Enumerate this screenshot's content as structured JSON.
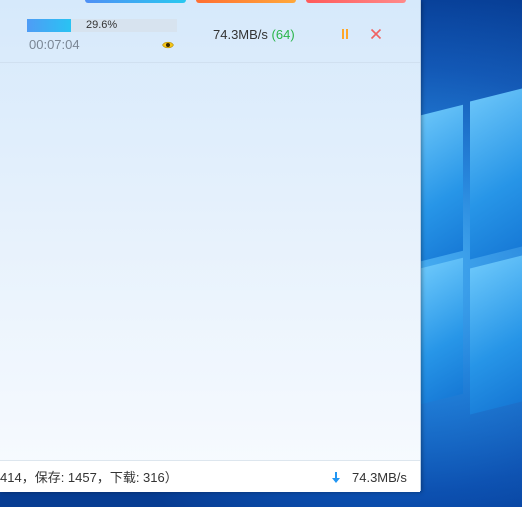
{
  "task": {
    "progress_percent": 29.6,
    "progress_label": "29.6%",
    "elapsed": "00:07:04",
    "speed": "74.3MB/s",
    "connections": "(64)",
    "icons": {
      "preview": "eye-icon",
      "pause": "pause-icon",
      "close": "close-icon"
    }
  },
  "status_bar": {
    "summary": "414，保存: 1457，下载: 316）",
    "speed": "74.3MB/s",
    "icon": "download-arrow-icon"
  },
  "colors": {
    "progress_start": "#4f9cf5",
    "progress_end": "#29c3f3",
    "connections": "#2ab54a",
    "pause": "#ffa726",
    "close": "#f06262",
    "download_icon": "#2196f3"
  }
}
